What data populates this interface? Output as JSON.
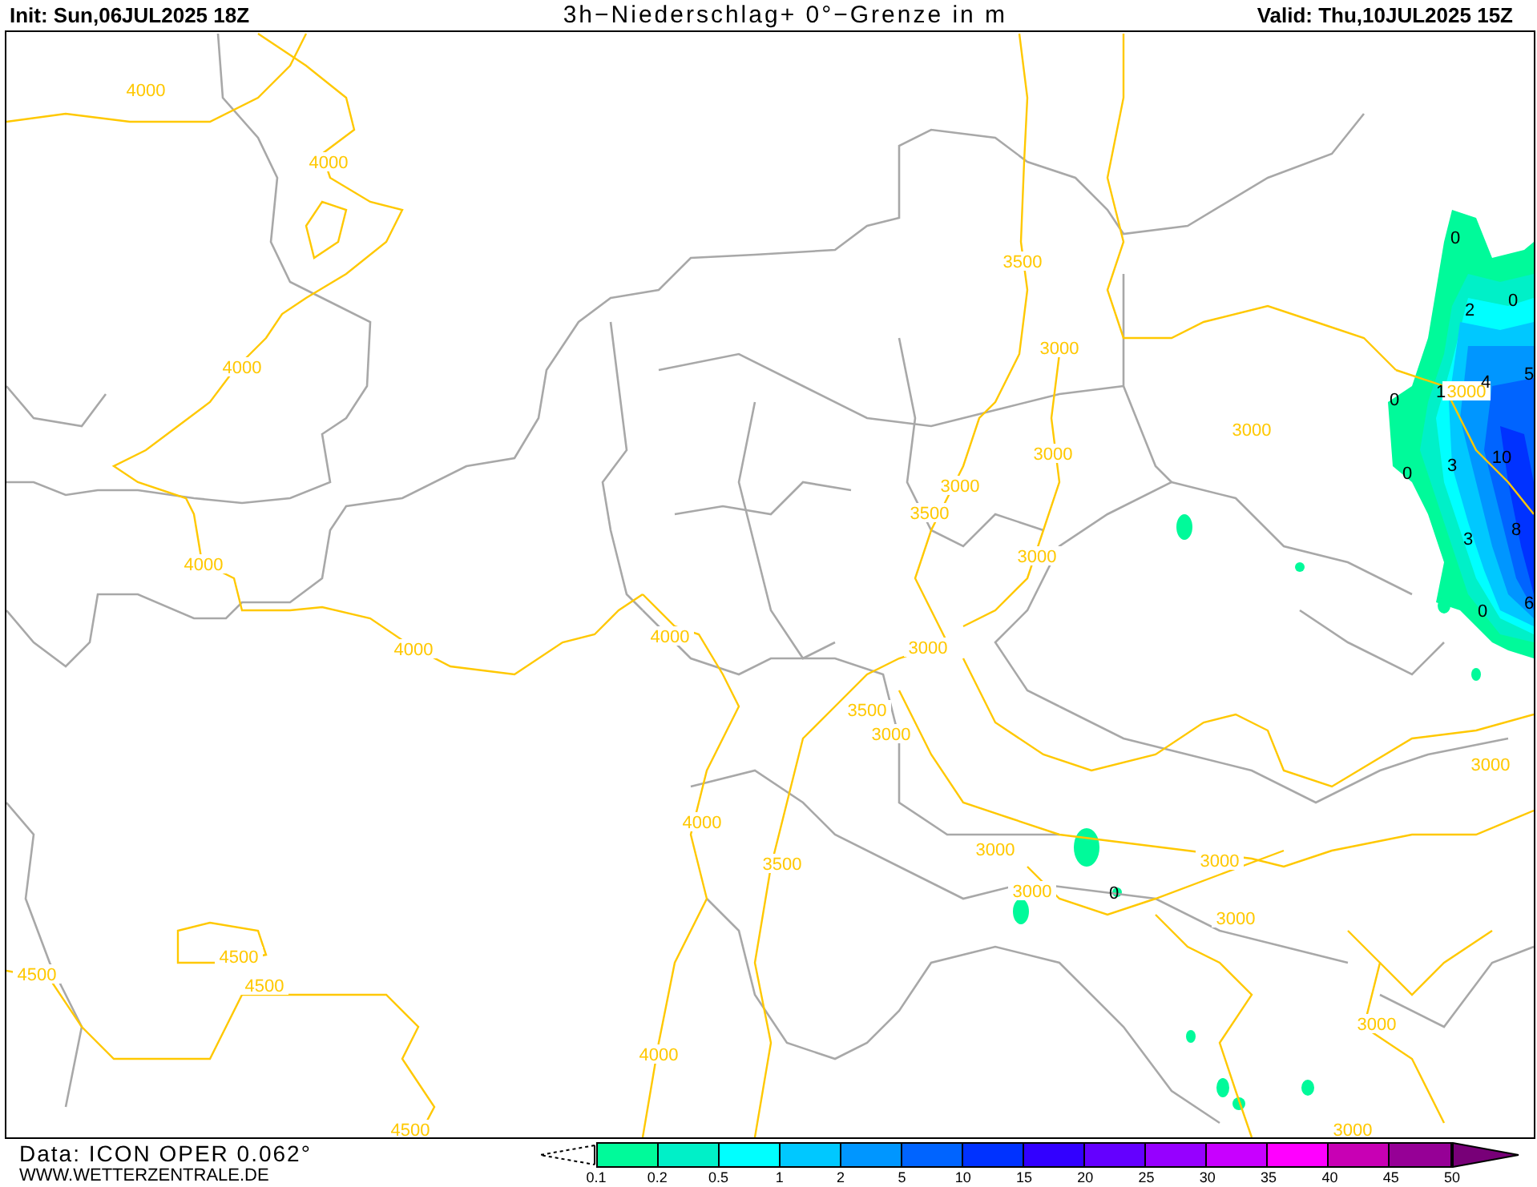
{
  "header": {
    "init": "Init: Sun,06JUL2025 18Z",
    "title": "3h−Niederschlag+ 0°−Grenze in m",
    "valid": "Valid: Thu,10JUL2025 15Z"
  },
  "map": {
    "contour_labels": [
      "4000",
      "4000",
      "4000",
      "4000",
      "4000",
      "4000",
      "3500",
      "3000",
      "3000",
      "3000",
      "3000",
      "3500",
      "3000",
      "3000",
      "3500",
      "3000",
      "4000",
      "3500",
      "3000",
      "3000",
      "3000",
      "3000",
      "3000",
      "4500",
      "4500",
      "4500",
      "4000",
      "3000",
      "3000",
      "4500",
      "3000"
    ],
    "precip_labels": [
      "0",
      "2",
      "0",
      "4",
      "5",
      "0",
      "1",
      "3",
      "10",
      "0",
      "3",
      "8",
      "0",
      "6",
      "0"
    ]
  },
  "footer": {
    "data_source": "Data: ICON OPER 0.062°",
    "website": "WWW.WETTERZENTRALE.DE"
  },
  "legend": {
    "bins": [
      {
        "color": "#00fa9a"
      },
      {
        "color": "#00f0c8"
      },
      {
        "color": "#00ffff"
      },
      {
        "color": "#00c8ff"
      },
      {
        "color": "#0096ff"
      },
      {
        "color": "#0064ff"
      },
      {
        "color": "#0032ff"
      },
      {
        "color": "#3200ff"
      },
      {
        "color": "#6400ff"
      },
      {
        "color": "#9600ff"
      },
      {
        "color": "#c800ff"
      },
      {
        "color": "#ff00ff"
      },
      {
        "color": "#c800b4"
      },
      {
        "color": "#960096"
      }
    ],
    "above": {
      "color": "#780078"
    },
    "ticks": [
      "0.1",
      "0.2",
      "0.5",
      "1",
      "2",
      "5",
      "10",
      "15",
      "20",
      "25",
      "30",
      "35",
      "40",
      "45",
      "50"
    ]
  }
}
